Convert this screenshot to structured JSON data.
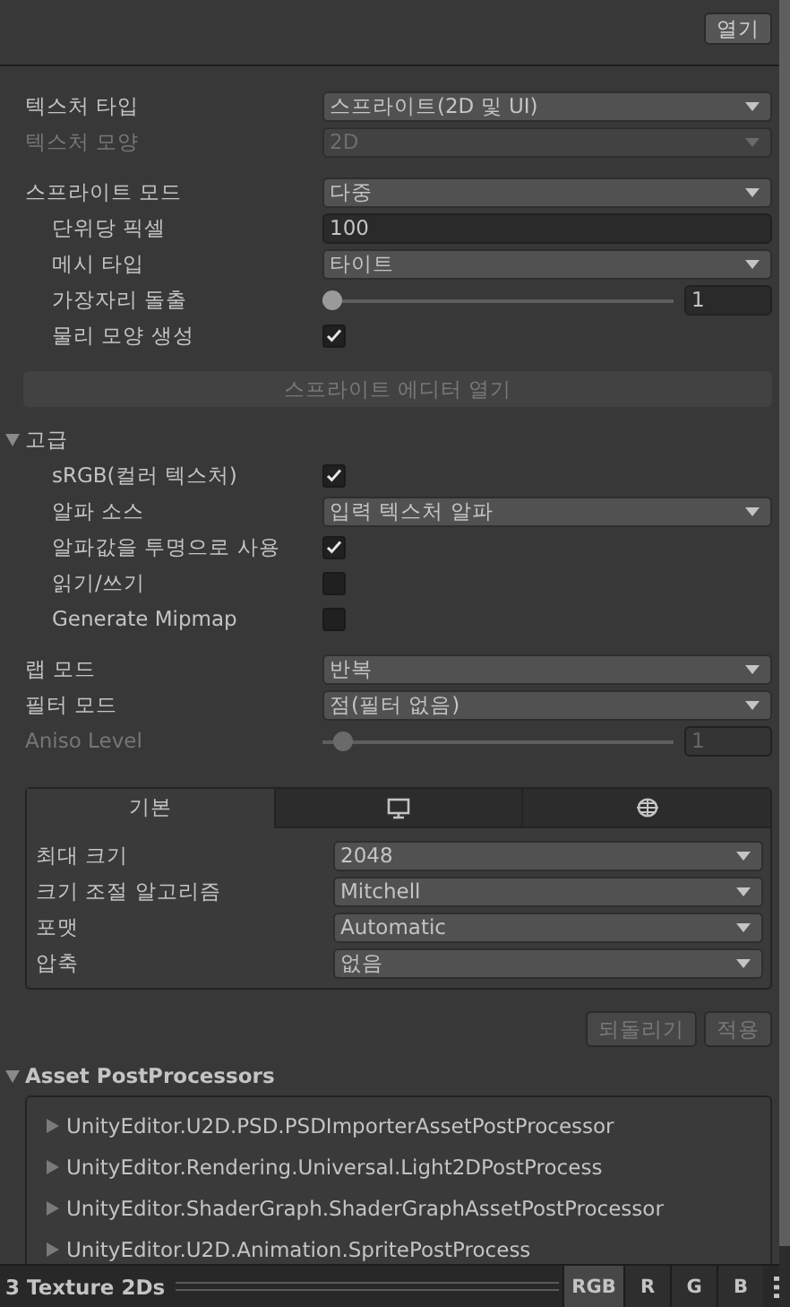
{
  "open_button": {
    "label": "열기"
  },
  "texture": {
    "rows": [
      {
        "kind": "dropdown",
        "label": "텍스처 타입",
        "value": "스프라이트(2D 및 UI)",
        "disabled": false
      },
      {
        "kind": "dropdown",
        "label": "텍스처 모양",
        "value": "2D",
        "disabled": true
      }
    ]
  },
  "sprite": {
    "rows": [
      {
        "kind": "dropdown",
        "label": "스프라이트 모드",
        "value": "다중",
        "disabled": false,
        "children": [
          {
            "kind": "number",
            "label": "단위당 픽셀",
            "value": "100",
            "disabled": false
          },
          {
            "kind": "dropdown",
            "label": "메시 타입",
            "value": "타이트",
            "disabled": false
          },
          {
            "kind": "slider",
            "label": "가장자리 돌출",
            "level": 0.03,
            "value": "1",
            "disabled": false
          },
          {
            "kind": "checkbox",
            "label": "물리 모양 생성",
            "checked": true,
            "disabled": false
          }
        ]
      }
    ],
    "editor_button": {
      "label": "스프라이트 에디터 열기",
      "disabled": true
    }
  },
  "advanced": {
    "title": "고급",
    "expanded": true,
    "rows": [
      {
        "kind": "checkbox",
        "label": "sRGB(컬러 텍스처)",
        "checked": true,
        "disabled": false
      },
      {
        "kind": "dropdown",
        "label": "알파 소스",
        "value": "입력 텍스처 알파",
        "disabled": false
      },
      {
        "kind": "checkbox",
        "label": "알파값을 투명으로 사용",
        "checked": true,
        "disabled": false
      },
      {
        "kind": "checkbox",
        "label": "읽기/쓰기",
        "checked": false,
        "disabled": false
      },
      {
        "kind": "checkbox",
        "label": "Generate Mipmap",
        "checked": false,
        "disabled": false
      }
    ]
  },
  "wrap": {
    "rows": [
      {
        "kind": "dropdown",
        "label": "랩 모드",
        "value": "반복",
        "disabled": false
      },
      {
        "kind": "dropdown",
        "label": "필터 모드",
        "value": "점(필터 없음)",
        "disabled": false
      },
      {
        "kind": "slider",
        "label": "Aniso Level",
        "level": 0.06,
        "value": "1",
        "disabled": true
      }
    ]
  },
  "platforms": {
    "tabs": [
      {
        "kind": "text",
        "label": "기본",
        "selected": true
      },
      {
        "kind": "monitor",
        "selected": false
      },
      {
        "kind": "globe",
        "selected": false
      }
    ],
    "rows": [
      {
        "kind": "dropdown",
        "label": "최대 크기",
        "value": "2048"
      },
      {
        "kind": "dropdown",
        "label": "크기 조절 알고리즘",
        "value": "Mitchell"
      },
      {
        "kind": "dropdown",
        "label": "포맷",
        "value": "Automatic"
      },
      {
        "kind": "dropdown",
        "label": "압축",
        "value": "없음"
      }
    ]
  },
  "actions": [
    {
      "label": "되돌리기",
      "disabled": true
    },
    {
      "label": "적용",
      "disabled": true
    }
  ],
  "post_processors": {
    "title": "Asset PostProcessors",
    "expanded": true,
    "items": [
      {
        "label": "UnityEditor.U2D.PSD.PSDImporterAssetPostProcessor",
        "expanded": false
      },
      {
        "label": "UnityEditor.Rendering.Universal.Light2DPostProcess",
        "expanded": false
      },
      {
        "label": "UnityEditor.ShaderGraph.ShaderGraphAssetPostProcessor",
        "expanded": false
      },
      {
        "label": "UnityEditor.U2D.Animation.SpritePostProcess",
        "expanded": false
      }
    ]
  },
  "status_bar": {
    "title": "3 Texture 2Ds",
    "channels": [
      {
        "label": "RGB",
        "selected": true
      },
      {
        "label": "R",
        "selected": false
      },
      {
        "label": "G",
        "selected": false
      },
      {
        "label": "B",
        "selected": false
      }
    ]
  }
}
